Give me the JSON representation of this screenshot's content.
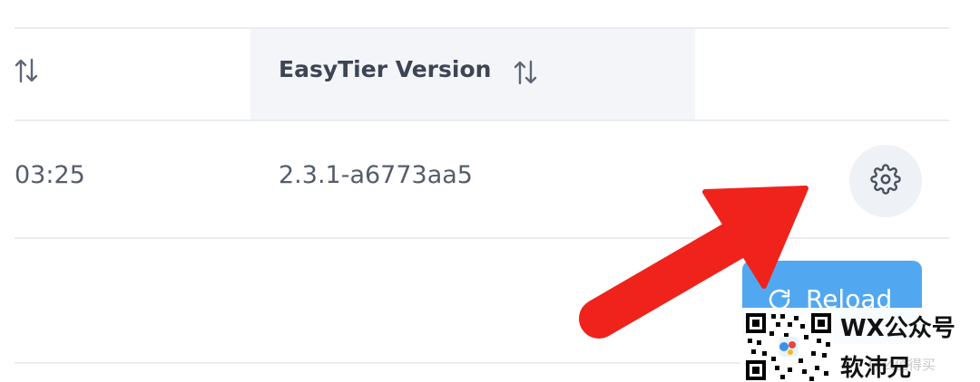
{
  "table": {
    "header": {
      "version_column": "EasyTier Version",
      "sort_icon": "sort-arrows-icon"
    },
    "row": {
      "time_fragment": "03:25",
      "version": "2.3.1-a6773aa5",
      "action_icon": "gear-icon"
    }
  },
  "toolbar": {
    "reload_label": "Reload",
    "reload_icon": "refresh-icon"
  },
  "annotation": {
    "arrow_icon": "red-pointer-arrow-icon",
    "arrow_color": "#f0221c"
  },
  "watermark": {
    "line1": "WX公众号",
    "line2": "软沛兄",
    "faint_text": "什么值得买"
  },
  "colors": {
    "header_shade": "#f3f5f8",
    "text": "#555d6b",
    "header_text": "#3d4555",
    "reload_button": "#52a8f0",
    "divider": "#e9edf2"
  }
}
